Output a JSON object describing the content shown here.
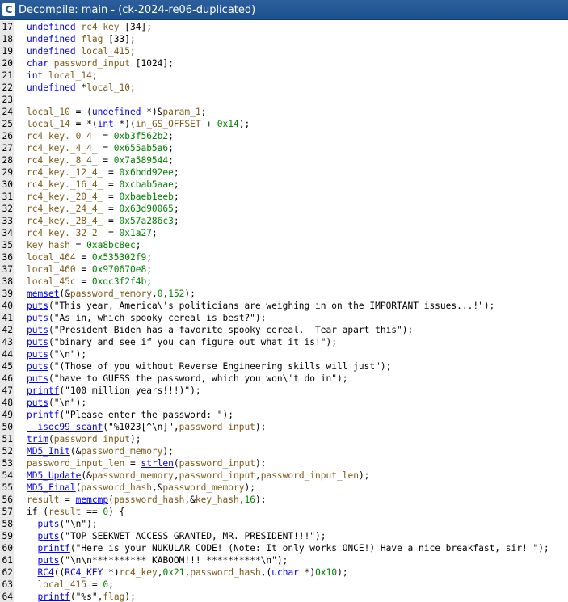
{
  "window": {
    "app_icon": "ghidra-decompiler-icon",
    "title": "Decompile: main - (ck-2024-re06-duplicated)"
  },
  "code": {
    "lines": [
      {
        "n": "17",
        "indent": 0,
        "tokens": [
          [
            "t",
            "undefined"
          ],
          [
            "p",
            " "
          ],
          [
            "v",
            "rc4_key"
          ],
          [
            "p",
            " [34];"
          ]
        ]
      },
      {
        "n": "18",
        "indent": 0,
        "tokens": [
          [
            "t",
            "undefined"
          ],
          [
            "p",
            " "
          ],
          [
            "v",
            "flag"
          ],
          [
            "p",
            " [33];"
          ]
        ]
      },
      {
        "n": "19",
        "indent": 0,
        "tokens": [
          [
            "t",
            "undefined"
          ],
          [
            "p",
            " "
          ],
          [
            "v",
            "local_415"
          ],
          [
            "p",
            ";"
          ]
        ]
      },
      {
        "n": "20",
        "indent": 0,
        "tokens": [
          [
            "t",
            "char"
          ],
          [
            "p",
            " "
          ],
          [
            "v",
            "password_input"
          ],
          [
            "p",
            " [1024];"
          ]
        ]
      },
      {
        "n": "21",
        "indent": 0,
        "tokens": [
          [
            "t",
            "int"
          ],
          [
            "p",
            " "
          ],
          [
            "v",
            "local_14"
          ],
          [
            "p",
            ";"
          ]
        ]
      },
      {
        "n": "22",
        "indent": 0,
        "tokens": [
          [
            "t",
            "undefined"
          ],
          [
            "p",
            " *"
          ],
          [
            "v",
            "local_10"
          ],
          [
            "p",
            ";"
          ]
        ]
      },
      {
        "n": "23",
        "indent": 0,
        "tokens": []
      },
      {
        "n": "24",
        "indent": 0,
        "tokens": [
          [
            "v",
            "local_10"
          ],
          [
            "p",
            " = ("
          ],
          [
            "t",
            "undefined"
          ],
          [
            "p",
            " *)&"
          ],
          [
            "v",
            "param_1"
          ],
          [
            "p",
            ";"
          ]
        ]
      },
      {
        "n": "25",
        "indent": 0,
        "tokens": [
          [
            "v",
            "local_14"
          ],
          [
            "p",
            " = *("
          ],
          [
            "t",
            "int"
          ],
          [
            "p",
            " *)("
          ],
          [
            "v",
            "in_GS_OFFSET"
          ],
          [
            "p",
            " + "
          ],
          [
            "n",
            "0x14"
          ],
          [
            "p",
            ");"
          ]
        ]
      },
      {
        "n": "26",
        "indent": 0,
        "tokens": [
          [
            "v",
            "rc4_key._0_4_"
          ],
          [
            "p",
            " = "
          ],
          [
            "n",
            "0xb3f562b2"
          ],
          [
            "p",
            ";"
          ]
        ]
      },
      {
        "n": "27",
        "indent": 0,
        "tokens": [
          [
            "v",
            "rc4_key._4_4_"
          ],
          [
            "p",
            " = "
          ],
          [
            "n",
            "0x655ab5a6"
          ],
          [
            "p",
            ";"
          ]
        ]
      },
      {
        "n": "28",
        "indent": 0,
        "tokens": [
          [
            "v",
            "rc4_key._8_4_"
          ],
          [
            "p",
            " = "
          ],
          [
            "n",
            "0x7a589544"
          ],
          [
            "p",
            ";"
          ]
        ]
      },
      {
        "n": "29",
        "indent": 0,
        "tokens": [
          [
            "v",
            "rc4_key._12_4_"
          ],
          [
            "p",
            " = "
          ],
          [
            "n",
            "0x6bdd92ee"
          ],
          [
            "p",
            ";"
          ]
        ]
      },
      {
        "n": "30",
        "indent": 0,
        "tokens": [
          [
            "v",
            "rc4_key._16_4_"
          ],
          [
            "p",
            " = "
          ],
          [
            "n",
            "0xcbab5aae"
          ],
          [
            "p",
            ";"
          ]
        ]
      },
      {
        "n": "31",
        "indent": 0,
        "tokens": [
          [
            "v",
            "rc4_key._20_4_"
          ],
          [
            "p",
            " = "
          ],
          [
            "n",
            "0xbaeb1eeb"
          ],
          [
            "p",
            ";"
          ]
        ]
      },
      {
        "n": "32",
        "indent": 0,
        "tokens": [
          [
            "v",
            "rc4_key._24_4_"
          ],
          [
            "p",
            " = "
          ],
          [
            "n",
            "0x63d90065"
          ],
          [
            "p",
            ";"
          ]
        ]
      },
      {
        "n": "33",
        "indent": 0,
        "tokens": [
          [
            "v",
            "rc4_key._28_4_"
          ],
          [
            "p",
            " = "
          ],
          [
            "n",
            "0x57a286c3"
          ],
          [
            "p",
            ";"
          ]
        ]
      },
      {
        "n": "34",
        "indent": 0,
        "tokens": [
          [
            "v",
            "rc4_key._32_2_"
          ],
          [
            "p",
            " = "
          ],
          [
            "n",
            "0x1a27"
          ],
          [
            "p",
            ";"
          ]
        ]
      },
      {
        "n": "35",
        "indent": 0,
        "tokens": [
          [
            "v",
            "key_hash"
          ],
          [
            "p",
            " = "
          ],
          [
            "n",
            "0xa8bc8ec"
          ],
          [
            "p",
            ";"
          ]
        ]
      },
      {
        "n": "36",
        "indent": 0,
        "tokens": [
          [
            "v",
            "local_464"
          ],
          [
            "p",
            " = "
          ],
          [
            "n",
            "0x535302f9"
          ],
          [
            "p",
            ";"
          ]
        ]
      },
      {
        "n": "37",
        "indent": 0,
        "tokens": [
          [
            "v",
            "local_460"
          ],
          [
            "p",
            " = "
          ],
          [
            "n",
            "0x970670e8"
          ],
          [
            "p",
            ";"
          ]
        ]
      },
      {
        "n": "38",
        "indent": 0,
        "tokens": [
          [
            "v",
            "local_45c"
          ],
          [
            "p",
            " = "
          ],
          [
            "n",
            "0xdc3f2f4b"
          ],
          [
            "p",
            ";"
          ]
        ]
      },
      {
        "n": "39",
        "indent": 0,
        "tokens": [
          [
            "f",
            "memset"
          ],
          [
            "p",
            "(&"
          ],
          [
            "v",
            "password_memory"
          ],
          [
            "p",
            ","
          ],
          [
            "n",
            "0"
          ],
          [
            "p",
            ","
          ],
          [
            "n",
            "152"
          ],
          [
            "p",
            ");"
          ]
        ]
      },
      {
        "n": "40",
        "indent": 0,
        "tokens": [
          [
            "f",
            "puts"
          ],
          [
            "p",
            "("
          ],
          [
            "s",
            "\"This year, America\\'s politicians are weighing in on the IMPORTANT issues...!\""
          ],
          [
            "p",
            ");"
          ]
        ]
      },
      {
        "n": "41",
        "indent": 0,
        "tokens": [
          [
            "f",
            "puts"
          ],
          [
            "p",
            "("
          ],
          [
            "s",
            "\"As in, which spooky cereal is best?\""
          ],
          [
            "p",
            ");"
          ]
        ]
      },
      {
        "n": "42",
        "indent": 0,
        "tokens": [
          [
            "f",
            "puts"
          ],
          [
            "p",
            "("
          ],
          [
            "s",
            "\"President Biden has a favorite spooky cereal.  Tear apart this\""
          ],
          [
            "p",
            ");"
          ]
        ]
      },
      {
        "n": "43",
        "indent": 0,
        "tokens": [
          [
            "f",
            "puts"
          ],
          [
            "p",
            "("
          ],
          [
            "s",
            "\"binary and see if you can figure out what it is!\""
          ],
          [
            "p",
            ");"
          ]
        ]
      },
      {
        "n": "44",
        "indent": 0,
        "tokens": [
          [
            "f",
            "puts"
          ],
          [
            "p",
            "("
          ],
          [
            "s",
            "\"\\n\""
          ],
          [
            "p",
            ");"
          ]
        ]
      },
      {
        "n": "45",
        "indent": 0,
        "tokens": [
          [
            "f",
            "puts"
          ],
          [
            "p",
            "("
          ],
          [
            "s",
            "\"(Those of you without Reverse Engineering skills will just\""
          ],
          [
            "p",
            ");"
          ]
        ]
      },
      {
        "n": "46",
        "indent": 0,
        "tokens": [
          [
            "f",
            "puts"
          ],
          [
            "p",
            "("
          ],
          [
            "s",
            "\"have to GUESS the password, which you won\\'t do in\""
          ],
          [
            "p",
            ");"
          ]
        ]
      },
      {
        "n": "47",
        "indent": 0,
        "tokens": [
          [
            "f",
            "printf"
          ],
          [
            "p",
            "("
          ],
          [
            "s",
            "\"100 million years!!!)\""
          ],
          [
            "p",
            ");"
          ]
        ]
      },
      {
        "n": "48",
        "indent": 0,
        "tokens": [
          [
            "f",
            "puts"
          ],
          [
            "p",
            "("
          ],
          [
            "s",
            "\"\\n\""
          ],
          [
            "p",
            ");"
          ]
        ]
      },
      {
        "n": "49",
        "indent": 0,
        "tokens": [
          [
            "f",
            "printf"
          ],
          [
            "p",
            "("
          ],
          [
            "s",
            "\"Please enter the password: \""
          ],
          [
            "p",
            ");"
          ]
        ]
      },
      {
        "n": "50",
        "indent": 0,
        "tokens": [
          [
            "f",
            "__isoc99_scanf"
          ],
          [
            "p",
            "("
          ],
          [
            "s",
            "\"%1023[^\\n]\""
          ],
          [
            "p",
            ","
          ],
          [
            "v",
            "password_input"
          ],
          [
            "p",
            ");"
          ]
        ]
      },
      {
        "n": "51",
        "indent": 0,
        "tokens": [
          [
            "f",
            "trim"
          ],
          [
            "p",
            "("
          ],
          [
            "v",
            "password_input"
          ],
          [
            "p",
            ");"
          ]
        ]
      },
      {
        "n": "52",
        "indent": 0,
        "tokens": [
          [
            "f",
            "MD5_Init"
          ],
          [
            "p",
            "(&"
          ],
          [
            "v",
            "password_memory"
          ],
          [
            "p",
            ");"
          ]
        ]
      },
      {
        "n": "53",
        "indent": 0,
        "tokens": [
          [
            "v",
            "password_input_len"
          ],
          [
            "p",
            " = "
          ],
          [
            "f",
            "strlen"
          ],
          [
            "p",
            "("
          ],
          [
            "v",
            "password_input"
          ],
          [
            "p",
            ");"
          ]
        ]
      },
      {
        "n": "54",
        "indent": 0,
        "tokens": [
          [
            "f",
            "MD5_Update"
          ],
          [
            "p",
            "(&"
          ],
          [
            "v",
            "password_memory"
          ],
          [
            "p",
            ","
          ],
          [
            "v",
            "password_input"
          ],
          [
            "p",
            ","
          ],
          [
            "v",
            "password_input_len"
          ],
          [
            "p",
            ");"
          ]
        ]
      },
      {
        "n": "55",
        "indent": 0,
        "tokens": [
          [
            "f",
            "MD5_Final"
          ],
          [
            "p",
            "("
          ],
          [
            "v",
            "password_hash"
          ],
          [
            "p",
            ",&"
          ],
          [
            "v",
            "password_memory"
          ],
          [
            "p",
            ");"
          ]
        ]
      },
      {
        "n": "56",
        "indent": 0,
        "tokens": [
          [
            "v",
            "result"
          ],
          [
            "p",
            " = "
          ],
          [
            "f",
            "memcmp"
          ],
          [
            "p",
            "("
          ],
          [
            "v",
            "password_hash"
          ],
          [
            "p",
            ",&"
          ],
          [
            "v",
            "key_hash"
          ],
          [
            "p",
            ","
          ],
          [
            "n",
            "16"
          ],
          [
            "p",
            ");"
          ]
        ]
      },
      {
        "n": "57",
        "indent": 0,
        "tokens": [
          [
            "k",
            "if"
          ],
          [
            "p",
            " ("
          ],
          [
            "v",
            "result"
          ],
          [
            "p",
            " == "
          ],
          [
            "n",
            "0"
          ],
          [
            "p",
            ") {"
          ]
        ]
      },
      {
        "n": "58",
        "indent": 1,
        "tokens": [
          [
            "f",
            "puts"
          ],
          [
            "p",
            "("
          ],
          [
            "s",
            "\"\\n\""
          ],
          [
            "p",
            ");"
          ]
        ]
      },
      {
        "n": "59",
        "indent": 1,
        "tokens": [
          [
            "f",
            "puts"
          ],
          [
            "p",
            "("
          ],
          [
            "s",
            "\"TOP SEEKWET ACCESS GRANTED, MR. PRESIDENT!!!\""
          ],
          [
            "p",
            ");"
          ]
        ]
      },
      {
        "n": "60",
        "indent": 1,
        "tokens": [
          [
            "f",
            "printf"
          ],
          [
            "p",
            "("
          ],
          [
            "s",
            "\"Here is your NUKULAR CODE! (Note: It only works ONCE!) Have a nice breakfast, sir! \""
          ],
          [
            "p",
            ");"
          ]
        ]
      },
      {
        "n": "61",
        "indent": 1,
        "tokens": [
          [
            "f",
            "puts"
          ],
          [
            "p",
            "("
          ],
          [
            "s",
            "\"\\n\\n********** KABOOM!!! **********\\n\""
          ],
          [
            "p",
            ");"
          ]
        ]
      },
      {
        "n": "62",
        "indent": 1,
        "tokens": [
          [
            "f",
            "RC4"
          ],
          [
            "p",
            "(("
          ],
          [
            "t",
            "RC4_KEY"
          ],
          [
            "p",
            " *)"
          ],
          [
            "v",
            "rc4_key"
          ],
          [
            "p",
            ","
          ],
          [
            "n",
            "0x21"
          ],
          [
            "p",
            ","
          ],
          [
            "v",
            "password_hash"
          ],
          [
            "p",
            ",("
          ],
          [
            "t",
            "uchar"
          ],
          [
            "p",
            " *)"
          ],
          [
            "n",
            "0x10"
          ],
          [
            "p",
            ");"
          ]
        ]
      },
      {
        "n": "63",
        "indent": 1,
        "tokens": [
          [
            "v",
            "local_415"
          ],
          [
            "p",
            " = "
          ],
          [
            "n",
            "0"
          ],
          [
            "p",
            ";"
          ]
        ]
      },
      {
        "n": "64",
        "indent": 1,
        "tokens": [
          [
            "f",
            "printf"
          ],
          [
            "p",
            "("
          ],
          [
            "s",
            "\"%s\""
          ],
          [
            "p",
            ","
          ],
          [
            "v",
            "flag"
          ],
          [
            "p",
            ");"
          ]
        ]
      }
    ]
  }
}
